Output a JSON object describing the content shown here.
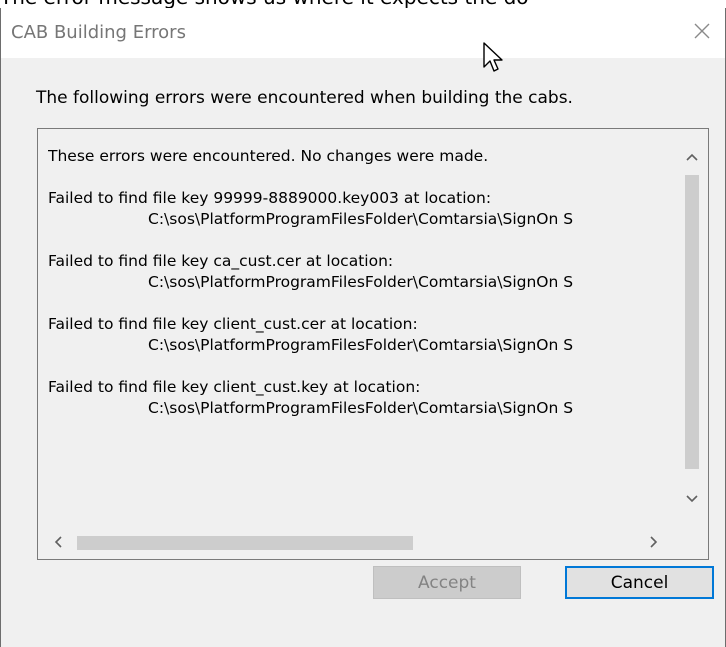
{
  "background": {
    "caption": "The error message shows us where it expects the do"
  },
  "dialog": {
    "title": "CAB Building Errors",
    "message": "The following errors were encountered when building the cabs.",
    "lines": [
      "These errors were encountered. No changes were made.",
      "",
      "Failed to find file key 99999-8889000.key003 at location:",
      "C:\\sos\\PlatformProgramFilesFolder\\Comtarsia\\SignOn S",
      "",
      "Failed to find file key ca_cust.cer at location:",
      "C:\\sos\\PlatformProgramFilesFolder\\Comtarsia\\SignOn S",
      "",
      "Failed to find file key client_cust.cer at location:",
      "C:\\sos\\PlatformProgramFilesFolder\\Comtarsia\\SignOn S",
      "",
      "Failed to find file key client_cust.key at location:",
      "C:\\sos\\PlatformProgramFilesFolder\\Comtarsia\\SignOn S"
    ],
    "buttons": {
      "accept_label": "Accept",
      "cancel_label": "Cancel"
    }
  },
  "colors": {
    "dialog_bg": "#f0f0f0",
    "title_text": "#767676",
    "cancel_border": "#0078d7",
    "accept_disabled_bg": "#cccccc"
  },
  "icons": [
    "close-icon",
    "scroll-up-icon",
    "scroll-down-icon",
    "scroll-left-icon",
    "scroll-right-icon",
    "mouse-cursor-icon"
  ]
}
